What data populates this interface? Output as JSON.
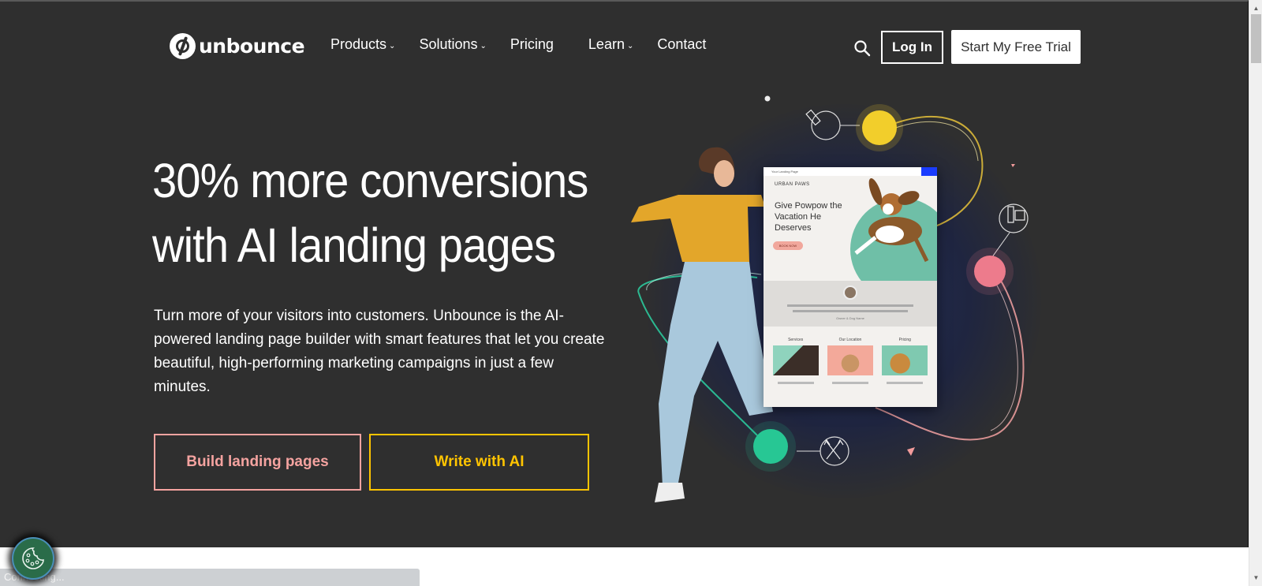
{
  "header": {
    "logo_text": "unbounce",
    "nav": [
      {
        "label": "Products",
        "has_dropdown": true
      },
      {
        "label": "Solutions",
        "has_dropdown": true
      },
      {
        "label": "Pricing",
        "has_dropdown": false
      },
      {
        "label": "Learn",
        "has_dropdown": true
      },
      {
        "label": "Contact",
        "has_dropdown": false
      }
    ],
    "chevron_glyph": "⌄",
    "search_icon": "search-icon",
    "login_label": "Log In",
    "trial_label": "Start My Free Trial"
  },
  "hero": {
    "title_line1": "30% more conversions",
    "title_line2": "with AI landing pages",
    "subtitle": "Turn more of your visitors into customers. Unbounce is the AI-powered landing page builder with smart features that let you create beautiful, high-performing marketing campaigns in just a few minutes.",
    "primary_cta": "Build landing pages",
    "secondary_cta": "Write with AI",
    "colors": {
      "background": "#2f2f2f",
      "primary_cta": "#f5a3a0",
      "secondary_cta": "#ffc400"
    }
  },
  "illustration": {
    "mock_page": {
      "tab_title": "Your Landing Page",
      "brand": "URBAN PAWS",
      "headline": "Give Powpow the Vacation He Deserves",
      "button": "BOOK NOW",
      "testimonial_name": "Owner & Dog Name",
      "cards": [
        "Services",
        "Our Location",
        "Pricing"
      ]
    }
  },
  "cookie_button": {
    "icon": "cookie-icon"
  },
  "status": {
    "text": "Connecting..."
  }
}
